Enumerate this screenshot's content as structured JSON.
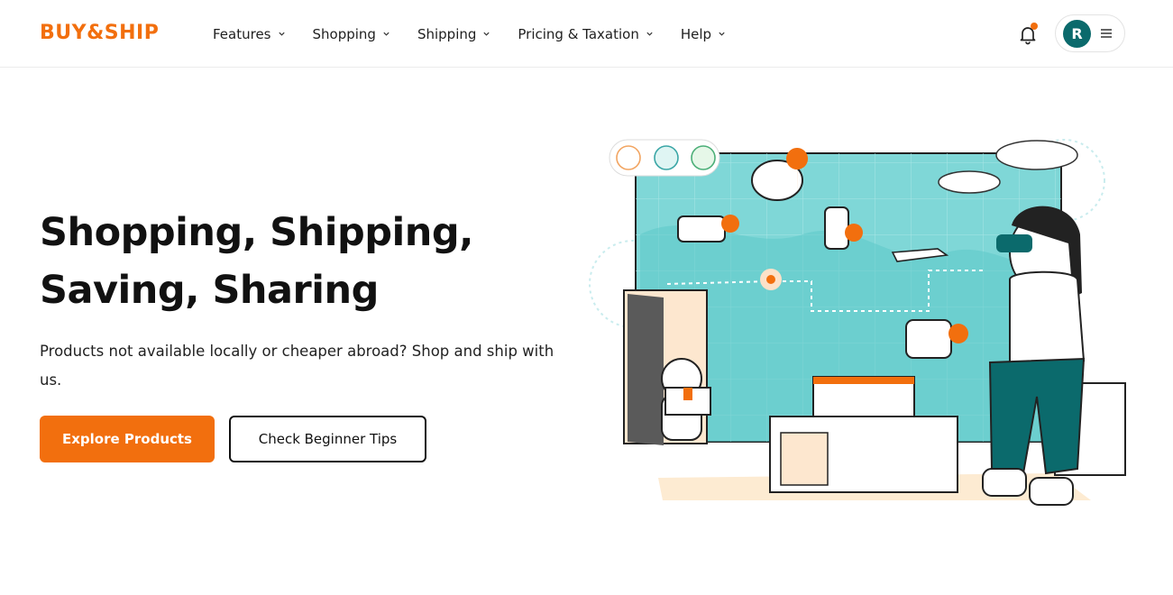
{
  "brand": {
    "logo_text": "BUY&SHIP",
    "accent": "#f26f0e",
    "teal": "#0b6a6c"
  },
  "nav": {
    "items": [
      {
        "label": "Features"
      },
      {
        "label": "Shopping"
      },
      {
        "label": "Shipping"
      },
      {
        "label": "Pricing & Taxation"
      },
      {
        "label": "Help"
      }
    ]
  },
  "header": {
    "avatar_initial": "R",
    "notification_icon": "bell-icon",
    "menu_icon": "hamburger-icon"
  },
  "hero": {
    "title_line1": "Shopping, Shipping,",
    "title_line2": "Saving, Sharing",
    "subtitle": "Products not available locally or cheaper abroad? Shop and ship with us.",
    "primary_button": "Explore Products",
    "secondary_button": "Check Beginner Tips"
  }
}
